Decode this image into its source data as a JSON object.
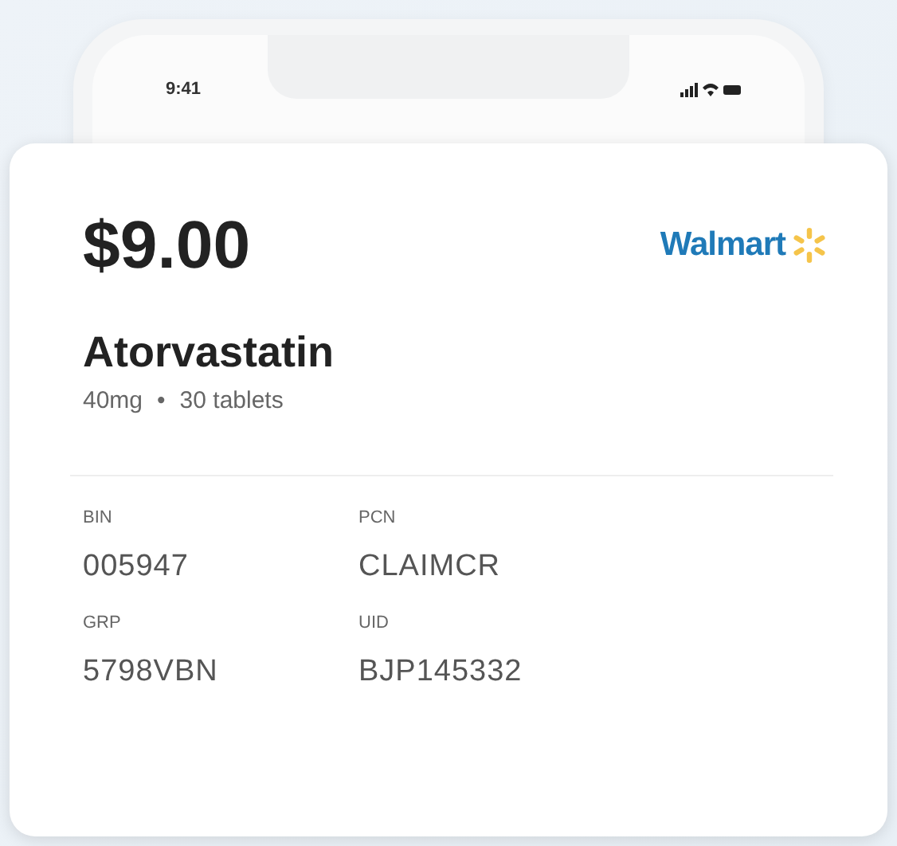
{
  "status_bar": {
    "time": "9:41"
  },
  "card": {
    "price": "$9.00",
    "pharmacy": "Walmart",
    "drug": "Atorvastatin",
    "strength": "40mg",
    "separator": "•",
    "quantity": "30 tablets",
    "fields": [
      {
        "label": "BIN",
        "value": "005947"
      },
      {
        "label": "PCN",
        "value": "CLAIMCR"
      },
      {
        "label": "GRP",
        "value": "5798VBN"
      },
      {
        "label": "UID",
        "value": "BJP145332"
      }
    ]
  }
}
